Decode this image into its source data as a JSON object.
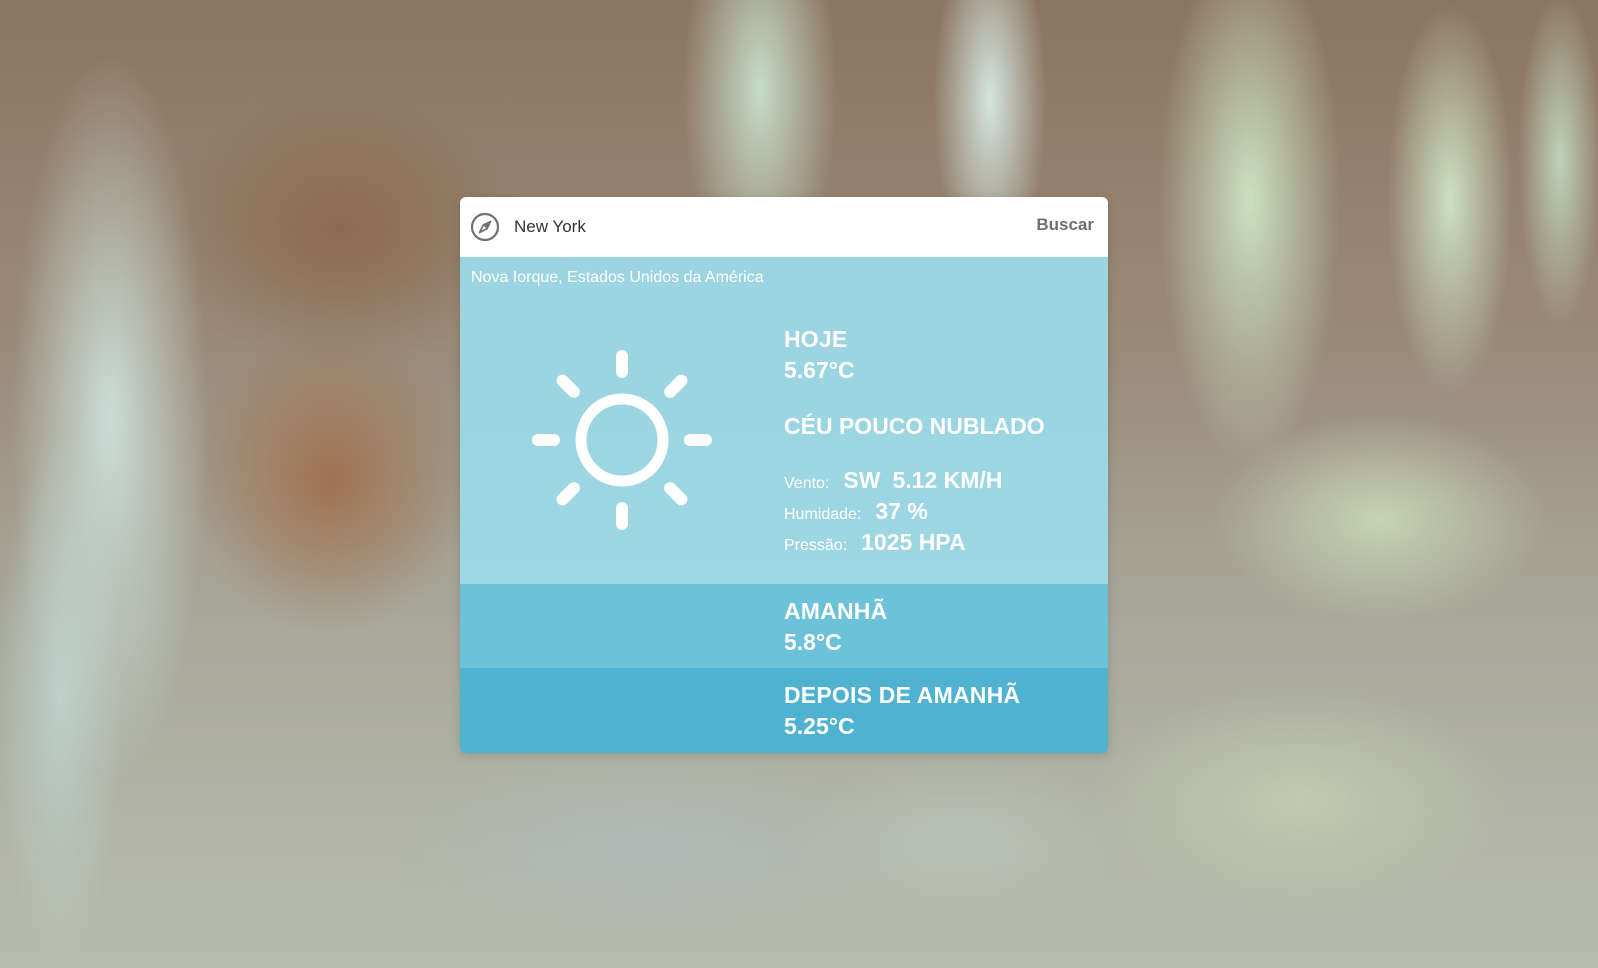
{
  "search": {
    "value": "New York",
    "button_label": "Buscar",
    "icon": "compass-icon"
  },
  "location": "Nova Iorque, Estados Unidos da América",
  "today": {
    "title": "HOJE",
    "temp": "5.67°C",
    "condition": "CÉU POUCO NUBLADO",
    "icon": "sun-icon",
    "wind_label": "Vento:",
    "wind_dir": "SW",
    "wind_speed": "5.12 KM/H",
    "humidity_label": "Humidade:",
    "humidity": "37 %",
    "pressure_label": "Pressão:",
    "pressure": "1025 HPA"
  },
  "tomorrow": {
    "title": "AMANHÃ",
    "temp": "5.8°C"
  },
  "after_tomorrow": {
    "title": "DEPOIS DE AMANHÃ",
    "temp": "5.25°C"
  },
  "colors": {
    "today_bg": "#9cdae9",
    "tomorrow_bg": "#66c4de",
    "after_bg": "#4ab2d4",
    "text": "#ffffff"
  }
}
